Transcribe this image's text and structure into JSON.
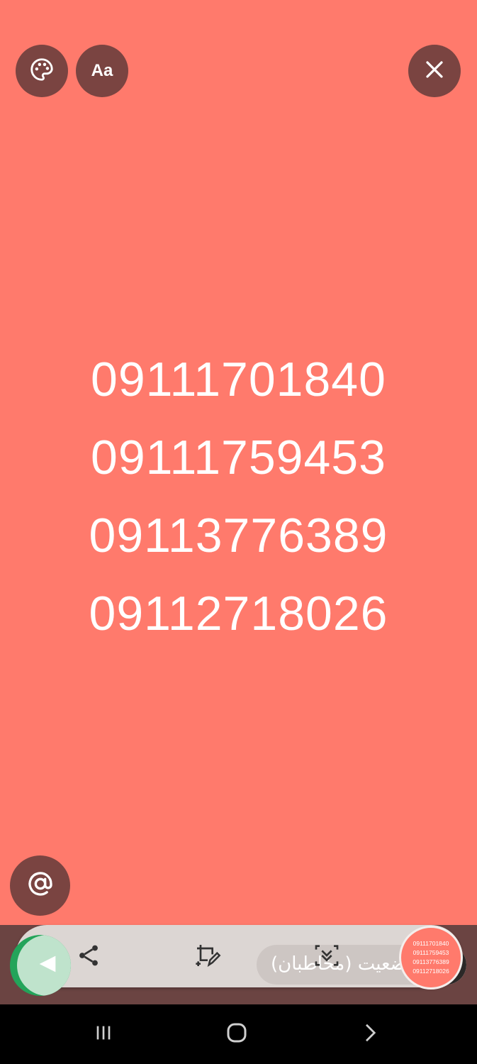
{
  "toolbar": {
    "palette_icon": "palette-icon",
    "font_label": "Aa",
    "close_icon": "close-icon"
  },
  "status_text": {
    "lines": [
      "09111701840",
      "09111759453",
      "09113776389",
      "09112718026"
    ],
    "background_color": "#ff7a6c",
    "text_color": "#ffffff"
  },
  "mention_icon": "at-icon",
  "composer": {
    "send_icon": "send-arrow-icon",
    "share_icon": "share-icon",
    "crop_icon": "crop-edit-icon",
    "swipe_icon": "swipe-down-icon",
    "caption_placeholder": "وضعیت (مخاطبان)"
  },
  "preview": {
    "lines": [
      "09111701840",
      "09111759453",
      "09113776389",
      "09112718026"
    ]
  },
  "navbar": {
    "recent_icon": "recent-apps-icon",
    "home_icon": "home-icon",
    "back_icon": "back-icon"
  }
}
